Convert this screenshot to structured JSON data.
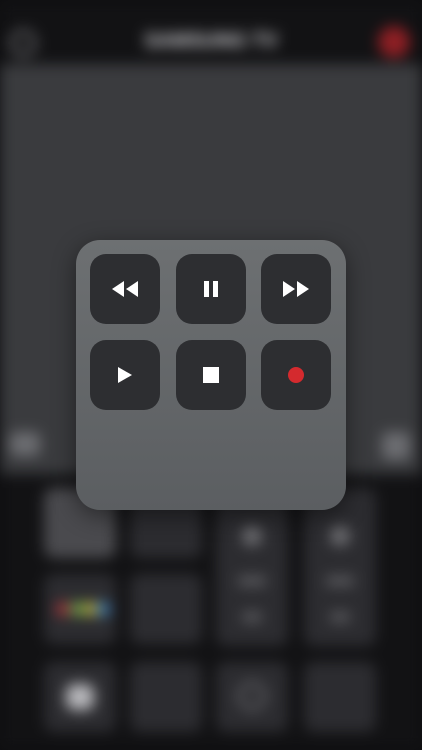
{
  "header": {
    "title": "SAMSUNG TV"
  },
  "playback_controls": {
    "row1": [
      {
        "icon": "rewind-icon"
      },
      {
        "icon": "pause-icon"
      },
      {
        "icon": "fast-forward-icon"
      }
    ],
    "row2": [
      {
        "icon": "play-icon"
      },
      {
        "icon": "stop-icon"
      },
      {
        "icon": "record-icon"
      }
    ],
    "icon_color": "#ffffff",
    "record_color": "#d42a2e",
    "button_color": "#2d2e31",
    "panel_color": "#676a6d"
  },
  "colors": {
    "power": "#8e1f24",
    "background": "#0e0e10",
    "touchpad": "#3a3b3e"
  }
}
